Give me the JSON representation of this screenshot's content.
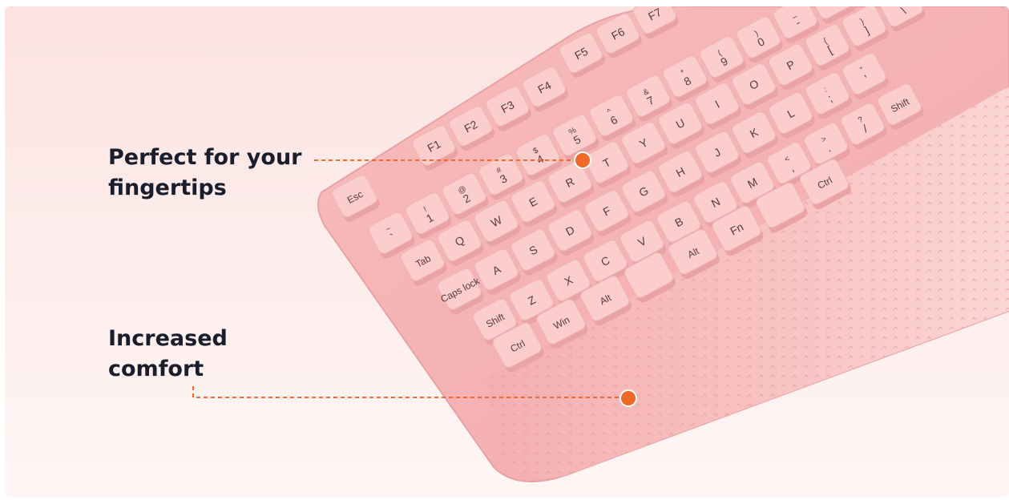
{
  "callouts": [
    {
      "title": "Perfect for your\nfingertips"
    },
    {
      "title": "Increased\ncomfort"
    }
  ],
  "colors": {
    "accent": "#f0682a",
    "heading": "#1a1d2b",
    "keyboard_pink": "#f6b7b7",
    "key_top": "#fbcdcd",
    "background": "#fde9e8"
  },
  "keyboard": {
    "function_keys": [
      {
        "label": "F1",
        "icon": "music-note-icon"
      },
      {
        "label": "F2",
        "icon": "volume-down-icon"
      },
      {
        "label": "F3",
        "icon": "volume-up-icon"
      },
      {
        "label": "F4",
        "icon": "mute-icon"
      },
      {
        "label": "F5",
        "icon": "previous-track-icon"
      },
      {
        "label": "F6",
        "icon": "next-track-icon"
      },
      {
        "label": "F7",
        "icon": "play-pause-icon"
      }
    ],
    "rows": [
      {
        "name": "esc-row",
        "keys": [
          {
            "main": "Esc"
          }
        ]
      },
      {
        "name": "number-row",
        "keys": [
          {
            "main": "`",
            "shift": "~"
          },
          {
            "main": "1",
            "shift": "!"
          },
          {
            "main": "2",
            "shift": "@"
          },
          {
            "main": "3",
            "shift": "#"
          },
          {
            "main": "4",
            "shift": "$"
          },
          {
            "main": "5",
            "shift": "%"
          },
          {
            "main": "6",
            "shift": "^"
          },
          {
            "main": "7",
            "shift": "&"
          },
          {
            "main": "8",
            "shift": "*"
          },
          {
            "main": "9",
            "shift": "("
          },
          {
            "main": "0",
            "shift": ")"
          },
          {
            "main": "-",
            "shift": "_"
          },
          {
            "main": "=",
            "shift": "+"
          }
        ]
      },
      {
        "name": "top-row",
        "keys": [
          {
            "main": "Tab"
          },
          {
            "main": "Q"
          },
          {
            "main": "W"
          },
          {
            "main": "E"
          },
          {
            "main": "R"
          },
          {
            "main": "T"
          },
          {
            "main": "Y"
          },
          {
            "main": "U"
          },
          {
            "main": "I"
          },
          {
            "main": "O"
          },
          {
            "main": "P"
          },
          {
            "main": "[",
            "shift": "{"
          },
          {
            "main": "]",
            "shift": "}"
          },
          {
            "main": "\\",
            "shift": "|"
          }
        ]
      },
      {
        "name": "home-row",
        "keys": [
          {
            "main": "Caps lock"
          },
          {
            "main": "A"
          },
          {
            "main": "S"
          },
          {
            "main": "D"
          },
          {
            "main": "F"
          },
          {
            "main": "G"
          },
          {
            "main": "H"
          },
          {
            "main": "J"
          },
          {
            "main": "K"
          },
          {
            "main": "L"
          },
          {
            "main": ";",
            "shift": ":"
          },
          {
            "main": "'",
            "shift": "\""
          }
        ]
      },
      {
        "name": "bottom-row",
        "keys": [
          {
            "main": "Shift",
            "icon": "shift-arrow-icon"
          },
          {
            "main": "Z"
          },
          {
            "main": "X"
          },
          {
            "main": "C"
          },
          {
            "main": "V"
          },
          {
            "main": "B"
          },
          {
            "main": "N"
          },
          {
            "main": "M"
          },
          {
            "main": ",",
            "shift": "<"
          },
          {
            "main": ".",
            "shift": ">"
          },
          {
            "main": "/",
            "shift": "?"
          },
          {
            "main": "Shift",
            "icon": "shift-arrow-icon"
          }
        ]
      },
      {
        "name": "modifier-row",
        "keys": [
          {
            "main": "Ctrl"
          },
          {
            "main": "Win"
          },
          {
            "main": "Alt"
          },
          {
            "main": ""
          },
          {
            "main": "Alt"
          },
          {
            "main": "Fn"
          },
          {
            "main": "",
            "icon": "menu-icon"
          },
          {
            "main": "Ctrl"
          }
        ]
      }
    ]
  }
}
